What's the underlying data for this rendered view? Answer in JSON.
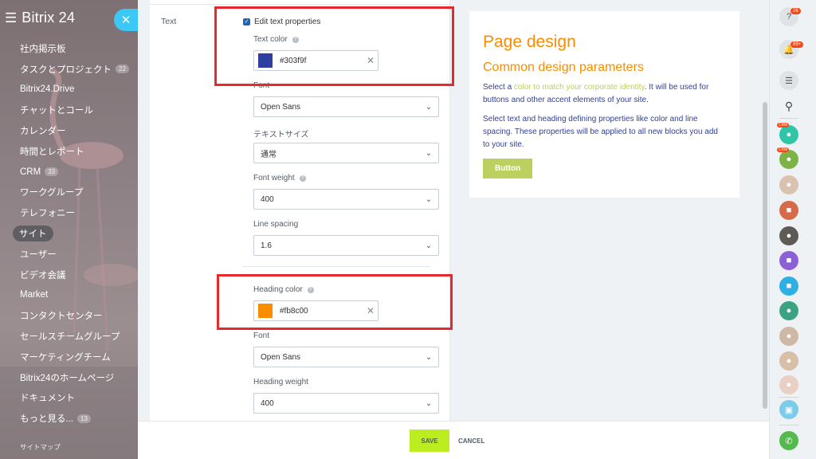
{
  "sidebar": {
    "logo": "Bitrix 24",
    "items": [
      {
        "label": "社内掲示板",
        "count": ""
      },
      {
        "label": "タスクとプロジェクト",
        "count": "22"
      },
      {
        "label": "Bitrix24.Drive",
        "count": ""
      },
      {
        "label": "チャットとコール",
        "count": ""
      },
      {
        "label": "カレンダー",
        "count": ""
      },
      {
        "label": "時間とレポート",
        "count": ""
      },
      {
        "label": "CRM",
        "count": "33"
      },
      {
        "label": "ワークグループ",
        "count": ""
      },
      {
        "label": "テレフォニー",
        "count": ""
      },
      {
        "label": "サイト",
        "count": "",
        "active": true
      },
      {
        "label": "ユーザー",
        "count": ""
      },
      {
        "label": "ビデオ会議",
        "count": ""
      },
      {
        "label": "Market",
        "count": ""
      },
      {
        "label": "コンタクトセンター",
        "count": ""
      },
      {
        "label": "セールスチームグループ",
        "count": ""
      },
      {
        "label": "マーケティングチーム",
        "count": ""
      },
      {
        "label": "Bitrix24のホームページ",
        "count": ""
      },
      {
        "label": "ドキュメント",
        "count": ""
      },
      {
        "label": "もっと見る...",
        "count": "13"
      }
    ],
    "sitemap": "サイトマップ"
  },
  "form": {
    "section_label": "Text",
    "edit_text_props": "Edit text properties",
    "text_color_label": "Text color",
    "text_color_value": "#303f9f",
    "font_label": "Font",
    "font_value": "Open Sans",
    "text_size_label": "テキストサイズ",
    "text_size_value": "通常",
    "font_weight_label": "Font weight",
    "font_weight_value": "400",
    "line_spacing_label": "Line spacing",
    "line_spacing_value": "1.6",
    "heading_color_label": "Heading color",
    "heading_color_value": "#fb8c00",
    "heading_font_label": "Font",
    "heading_font_value": "Open Sans",
    "heading_weight_label": "Heading weight",
    "heading_weight_value": "400"
  },
  "preview": {
    "title": "Page design",
    "subtitle": "Common design parameters",
    "p1_before": "Select a ",
    "p1_link": "color to match your corporate identity",
    "p1_after": ". It will be used for buttons and other accent elements of your site.",
    "p2": "Select text and heading defining properties like color and line spacing. These properties will be applied to all new blocks you add to your site.",
    "button": "Button"
  },
  "footer": {
    "save": "SAVE",
    "cancel": "CANCEL"
  },
  "rail": {
    "help_badge": "26",
    "notif_badge": "99+",
    "crm_tag": "CRM"
  },
  "colors": {
    "text_color": "#303f9f",
    "heading_color": "#fb8c00",
    "accent": "#bcd060",
    "save_btn": "#bbed21",
    "close_btn": "#3bc8f5"
  }
}
